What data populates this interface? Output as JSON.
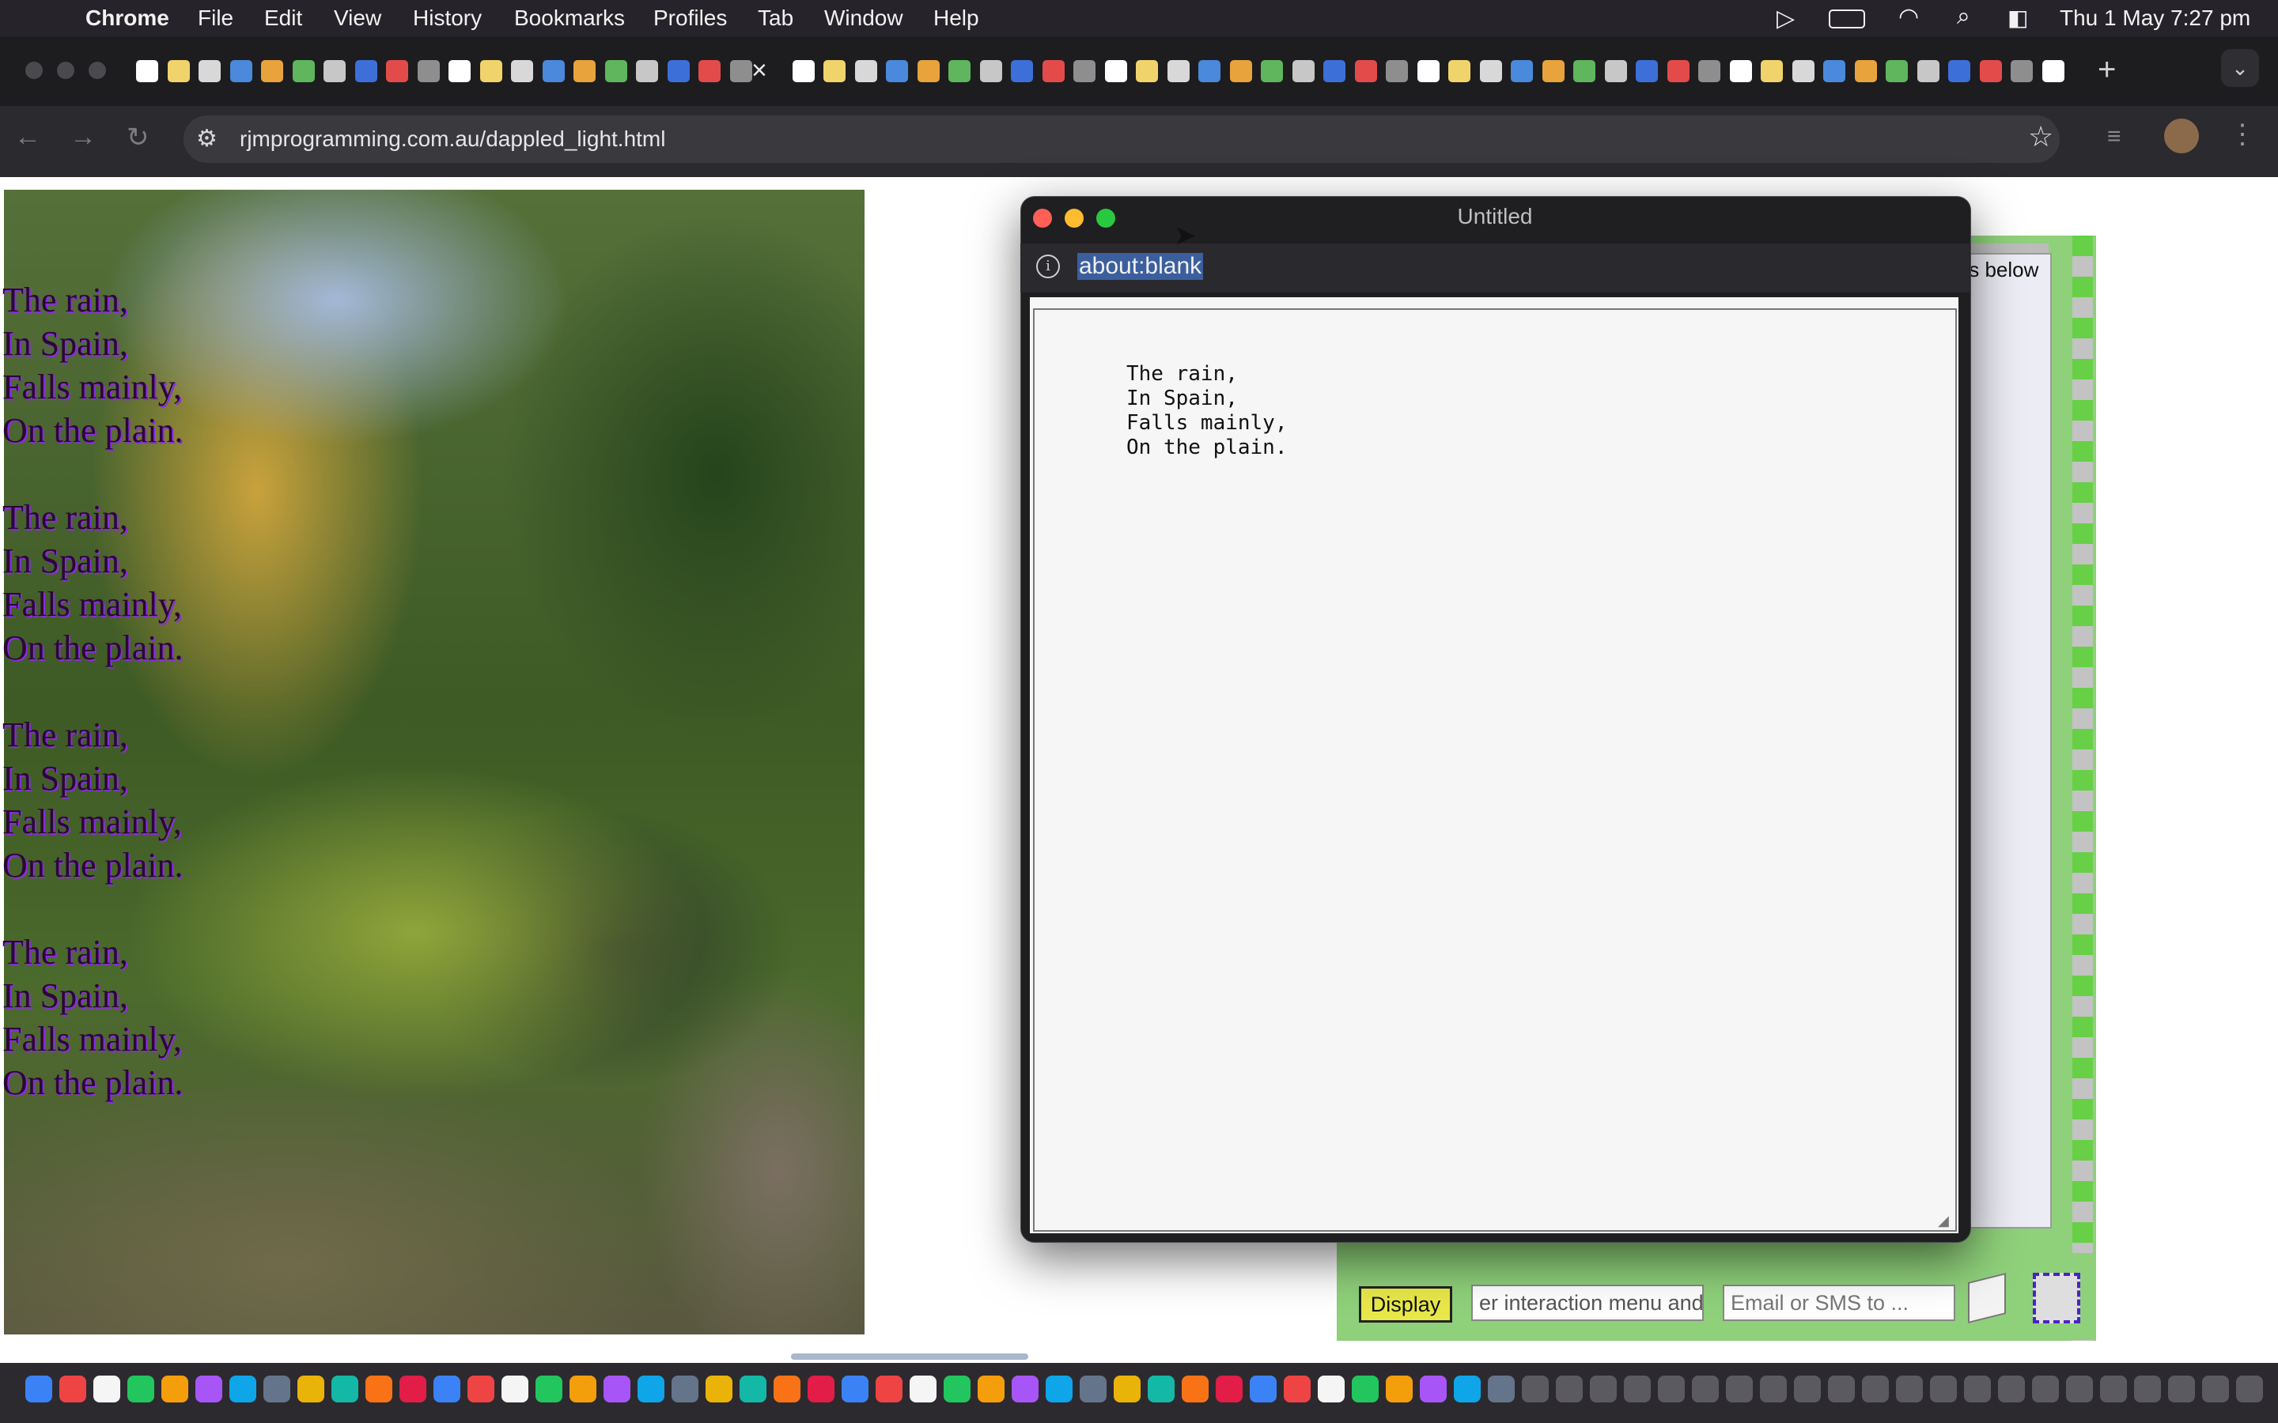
{
  "menubar": {
    "app": "Chrome",
    "items": [
      "File",
      "Edit",
      "View",
      "History",
      "Bookmarks",
      "Profiles",
      "Tab",
      "Window",
      "Help"
    ],
    "clock": "Thu 1 May  7:27 pm"
  },
  "browser": {
    "url": "rjmprogramming.com.au/dappled_light.html",
    "tab_close": "×",
    "new_tab": "+"
  },
  "poem": {
    "lines": [
      "The rain,",
      "In Spain,",
      "Falls mainly,",
      "On the plain."
    ]
  },
  "popup": {
    "title": "Untitled",
    "address": "about:blank",
    "textarea_lines": [
      "The rain,",
      "In Spain,",
      "Falls mainly,",
      "On the plain."
    ]
  },
  "right_panel": {
    "hint_text": "ts below",
    "display_button": "Display",
    "interaction_input_value": "er interaction menu and",
    "email_placeholder": "Email or SMS to ..."
  },
  "colors": {
    "menubar_bg": "#26242a",
    "popup_bg": "#1f1f21",
    "panel_green": "#8fd07a",
    "display_button_bg": "#e8e84a",
    "poem_text": "#2a0836",
    "poem_shadow": "#8a2be2"
  }
}
